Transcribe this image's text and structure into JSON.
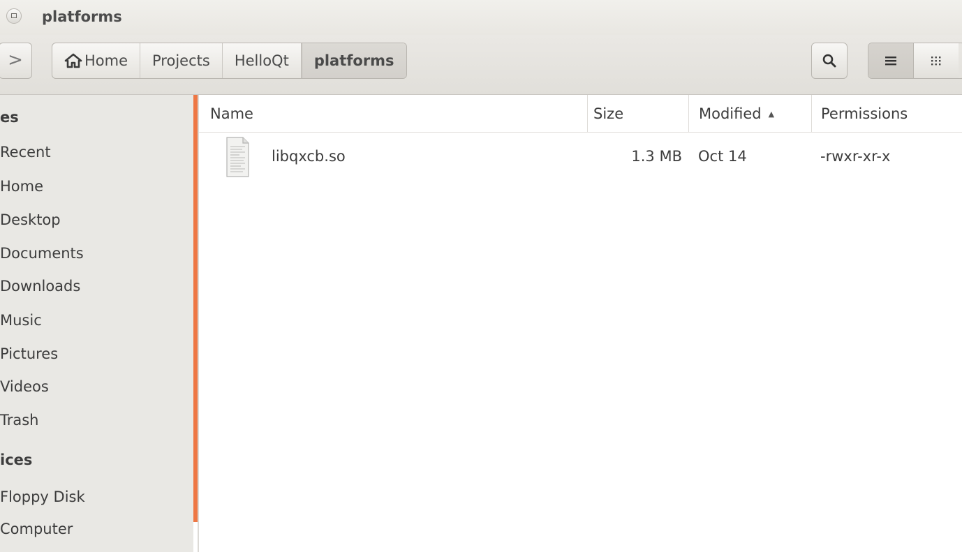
{
  "window": {
    "title": "platforms"
  },
  "toolbar": {
    "back_glyph": ">",
    "breadcrumbs": [
      "Home",
      "Projects",
      "HelloQt",
      "platforms"
    ],
    "search_icon": "search-icon",
    "list_view_icon": "list-view-icon",
    "grid_view_icon": "grid-view-icon"
  },
  "sidebar": {
    "section_places": "es",
    "places": [
      "Recent",
      "Home",
      "Desktop",
      "Documents",
      "Downloads",
      "Music",
      "Pictures",
      "Videos",
      "Trash"
    ],
    "section_devices": "ices",
    "devices": [
      "Floppy Disk",
      "Computer"
    ],
    "scrollbar_color": "#ee7744"
  },
  "columns": {
    "name": "Name",
    "size": "Size",
    "modified": "Modified",
    "permissions": "Permissions",
    "sort_indicator": "▲"
  },
  "files": [
    {
      "name": "libqxcb.so",
      "size": "1.3 MB",
      "modified": "Oct 14",
      "permissions": "-rwxr-xr-x",
      "icon": "text-document-icon"
    }
  ]
}
